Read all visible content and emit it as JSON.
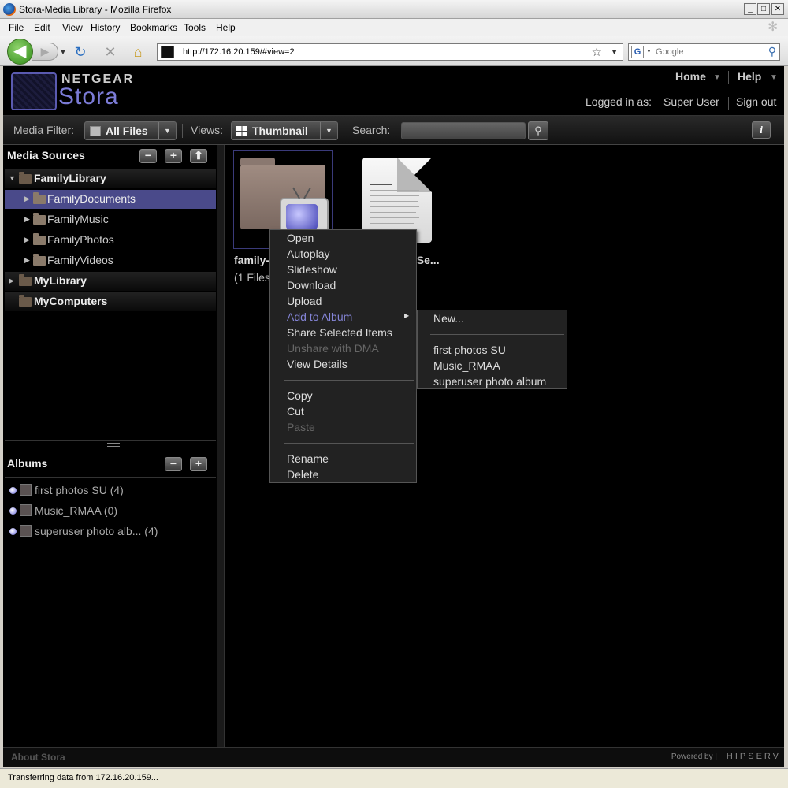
{
  "window": {
    "title": "Stora-Media Library - Mozilla Firefox"
  },
  "menubar": [
    "File",
    "Edit",
    "View",
    "History",
    "Bookmarks",
    "Tools",
    "Help"
  ],
  "navbar": {
    "url": "http://172.16.20.159/#view=2",
    "search_placeholder": "Google"
  },
  "header": {
    "brand": "NETGEAR",
    "product": "Stora",
    "home": "Home",
    "help": "Help",
    "logged_in_label": "Logged in as:",
    "user": "Super User",
    "sign_out": "Sign out"
  },
  "toolbar": {
    "media_filter_label": "Media Filter:",
    "media_filter_value": "All Files",
    "views_label": "Views:",
    "views_value": "Thumbnail",
    "search_label": "Search:"
  },
  "media_sources": {
    "title": "Media Sources",
    "items": [
      {
        "label": "FamilyLibrary",
        "level": 0,
        "expanded": true
      },
      {
        "label": "FamilyDocuments",
        "level": 1,
        "selected": true
      },
      {
        "label": "FamilyMusic",
        "level": 1
      },
      {
        "label": "FamilyPhotos",
        "level": 1
      },
      {
        "label": "FamilyVideos",
        "level": 1
      },
      {
        "label": "MyLibrary",
        "level": 0
      },
      {
        "label": "MyComputers",
        "level": 0
      }
    ]
  },
  "albums": {
    "title": "Albums",
    "items": [
      "first photos SU (4)",
      "Music_RMAA (0)",
      "superuser photo alb... (4)"
    ]
  },
  "content": {
    "files": [
      {
        "name": "family-",
        "sub": "(1 Files"
      },
      {
        "name": "9Se..."
      }
    ]
  },
  "context_menu": {
    "items": [
      "Open",
      "Autoplay",
      "Slideshow",
      "Download",
      "Upload",
      "Add to Album",
      "Share Selected Items",
      "Unshare with DMA",
      "View Details",
      "Copy",
      "Cut",
      "Paste",
      "Rename",
      "Delete"
    ]
  },
  "submenu": {
    "items": [
      "New...",
      "first photos SU",
      "Music_RMAA",
      "superuser photo album"
    ]
  },
  "footer": {
    "about": "About Stora",
    "powered": "Powered by |",
    "brand": "HIPSERV"
  },
  "statusbar": {
    "text": "Transferring data from 172.16.20.159..."
  }
}
